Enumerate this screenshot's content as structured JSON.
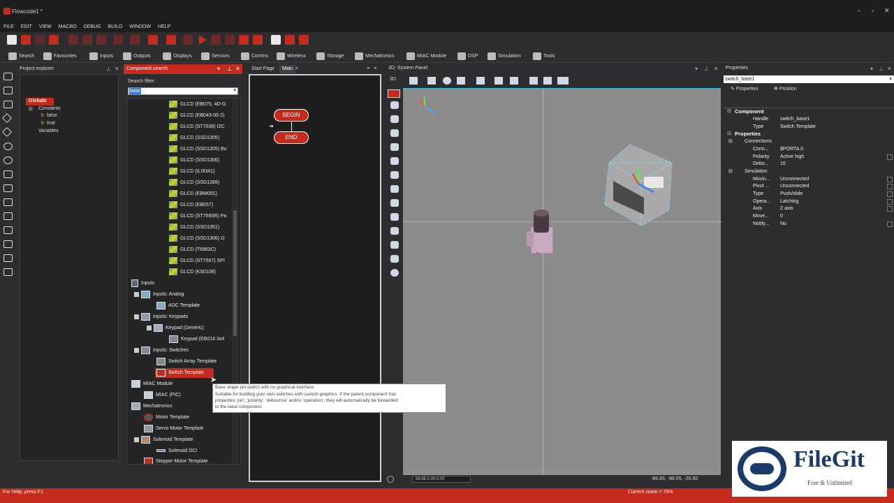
{
  "window": {
    "title": "Flowcode1 *"
  },
  "menu": [
    "FILE",
    "EDIT",
    "VIEW",
    "MACRO",
    "DEBUG",
    "BUILD",
    "WINDOW",
    "HELP"
  ],
  "toolbar_categories": [
    {
      "label": "Search",
      "icon": "search-icon"
    },
    {
      "label": "Favourites",
      "icon": "star-icon"
    },
    {
      "label": "Inputs",
      "icon": "inputs-icon"
    },
    {
      "label": "Outputs",
      "icon": "outputs-icon"
    },
    {
      "label": "Displays",
      "icon": "display-icon"
    },
    {
      "label": "Sensors",
      "icon": "sensor-icon"
    },
    {
      "label": "Comms",
      "icon": "comms-icon"
    },
    {
      "label": "Wireless",
      "icon": "wireless-icon"
    },
    {
      "label": "Storage",
      "icon": "storage-icon"
    },
    {
      "label": "Mechatronics",
      "icon": "mechatronics-icon"
    },
    {
      "label": "MIAC Module",
      "icon": "miac-icon"
    },
    {
      "label": "DSP",
      "icon": "dsp-icon"
    },
    {
      "label": "Simulation",
      "icon": "gear-icon"
    },
    {
      "label": "Tools",
      "icon": "tools-icon"
    }
  ],
  "project_explorer": {
    "title": "Project explorer",
    "tree": {
      "root": "Globals",
      "constants": "Constants",
      "const_false": "false",
      "const_true": "true",
      "variables": "Variables"
    }
  },
  "component_search": {
    "title": "Component search",
    "filter_label": "Search filter:",
    "filter_value": "base",
    "items": [
      "GLCD (EB075, 4D-G",
      "GLCD (EB043-00-2)",
      "GLCD (ST7036) I2C",
      "GLCD (SSD1305)",
      "GLCD (SSD1305) Bu",
      "GLCD (SSD1306)",
      "GLCD (ILI9341)",
      "GLCD (SSD1289)",
      "GLCD (EBM001)",
      "GLCD (EB057)",
      "GLCD (ST7565R) Pa",
      "GLCD (SSD1351)",
      "GLCD (SSD1306) I2",
      "GLCD (T6963C)",
      "GLCD (ST7567) SPI",
      "GLCD (KS0108)"
    ],
    "groups": {
      "inputs": "Inputs",
      "inputs_analog": "Inputs: Analog",
      "adc_template": "ADC Template",
      "inputs_keypads": "Inputs: Keypads",
      "keypad_generic": "Keypad (Generic)",
      "keypad_eb014": "Keypad (EB014 3x4",
      "inputs_switches": "Inputs: Switches",
      "switch_array": "Switch Array Template",
      "switch_template": "Switch Template",
      "miac_module": "MIAC Module",
      "miac_pic": "MIAC (PIC)",
      "mechatronics": "Mechatronics",
      "motor_template": "Motor Template",
      "servo_template": "Servo Motor Template",
      "solenoid_template": "Solenoid Template",
      "solenoid_dci": "Solenoid DCI",
      "stepper_template": "Stepper Motor Template"
    }
  },
  "tooltip": {
    "line1": "Base single pin switch with no graphical interface",
    "line2": "Suitable for building your own switches with custom graphics.  If the parent component has",
    "line3": "properties 'pin', 'polarity', 'debounce' and/or 'operation', they will automatically be forwarded",
    "line4": "to the base component."
  },
  "flowchart": {
    "tab_start": "Start Page",
    "tab_main": "Main",
    "begin": "BEGIN",
    "end": "END"
  },
  "system_panel": {
    "title": "3D: System Panel",
    "mode": "3D",
    "coord_input": "88.86.0.00.0.00",
    "coords": "-89.85, -88.55, -26.60"
  },
  "properties": {
    "title": "Properties",
    "selected": "switch_base1",
    "tab_properties": "Properties",
    "tab_position": "Position",
    "section_component": "Component",
    "section_properties": "Properties",
    "rows": [
      {
        "key": "Handle",
        "value": "switch_base1",
        "dd": false
      },
      {
        "key": "Type",
        "value": "Switch Template",
        "dd": false
      },
      {
        "key": "Connections",
        "value": "",
        "dd": false
      },
      {
        "key": "Conn...",
        "value": "$PORTA.0",
        "dd": false
      },
      {
        "key": "Polarity",
        "value": "Active high",
        "dd": true
      },
      {
        "key": "Debo...",
        "value": "10",
        "dd": false
      },
      {
        "key": "Simulation",
        "value": "",
        "dd": false
      },
      {
        "key": "Movin...",
        "value": "Unconnected",
        "dd": true
      },
      {
        "key": "Pivot ...",
        "value": "Unconnected",
        "dd": true
      },
      {
        "key": "Type",
        "value": "Push/slide",
        "dd": true
      },
      {
        "key": "Opera...",
        "value": "Latching",
        "dd": true
      },
      {
        "key": "Axis",
        "value": "Z axis",
        "dd": true
      },
      {
        "key": "Move...",
        "value": "0",
        "dd": false
      },
      {
        "key": "Notify...",
        "value": "No",
        "dd": true
      }
    ]
  },
  "status": {
    "help": "For Help, press F1",
    "zoom": "Current zoom = 75%"
  },
  "watermark": {
    "brand": "FileGit",
    "tagline": "Free & Unlimited"
  },
  "colors": {
    "accent": "#c42b1c",
    "panel": "#2d2d30",
    "viewport": "#8c8c8c",
    "selection": "#2bb7d6"
  }
}
